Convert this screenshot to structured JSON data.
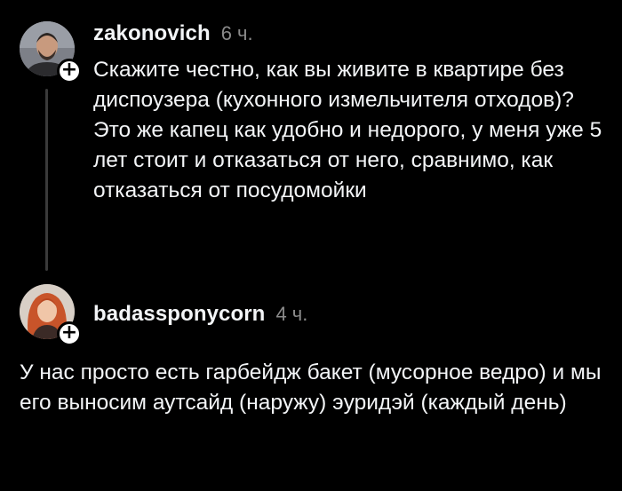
{
  "posts": [
    {
      "username": "zakonovich",
      "time": "6 ч.",
      "text": "Скажите честно, как вы живите в квартире без диспоузера (кухонного измельчителя отходов)? Это же капец как удобно и недорого, у меня уже 5 лет стоит и отказаться от него, сравнимо, как отказаться от посудомойки",
      "follow_icon": "plus-icon"
    },
    {
      "username": "badassponycorn",
      "time": "4 ч.",
      "text": "У нас просто есть гарбейдж бакет (мусорное ведро) и мы его выносим аутсайд (наружу) эуридэй (каждый день)",
      "follow_icon": "plus-icon"
    }
  ],
  "colors": {
    "background": "#000000",
    "primary_text": "#f3f5f7",
    "secondary_text": "#8a8a8a",
    "thread_line": "#3a3a3a"
  }
}
